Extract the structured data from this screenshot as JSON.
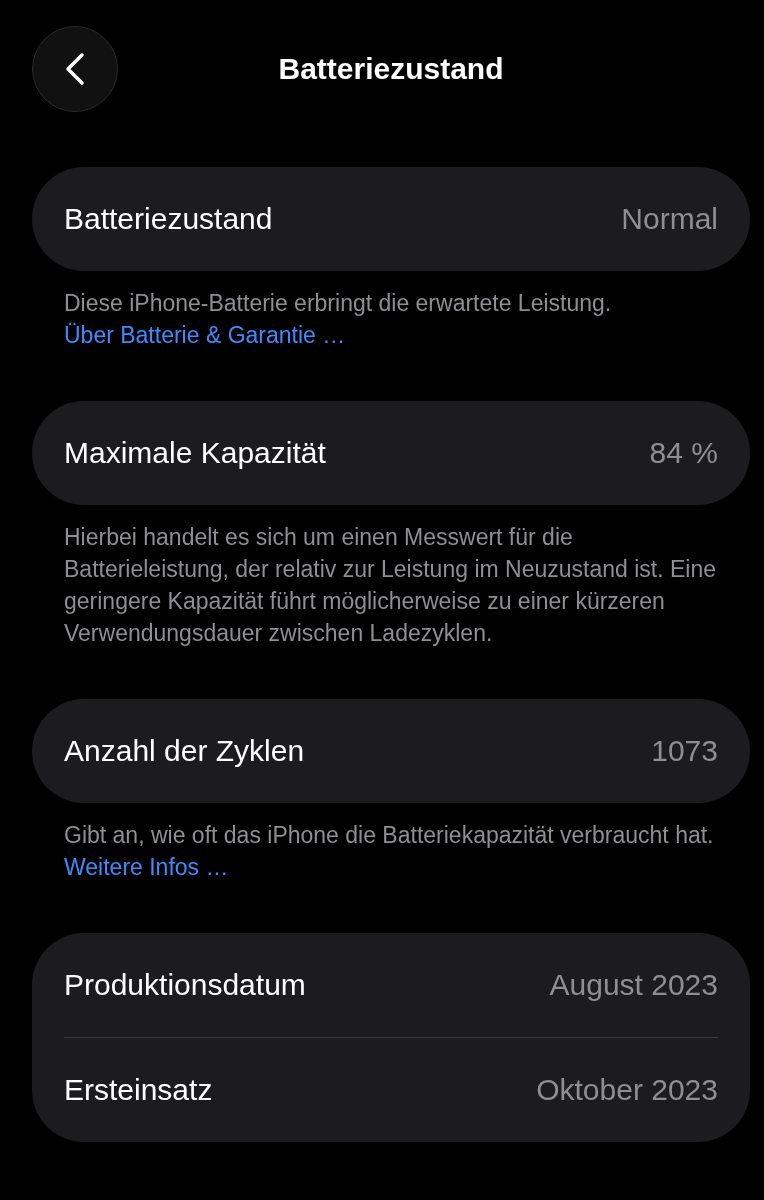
{
  "header": {
    "title": "Batteriezustand"
  },
  "sections": [
    {
      "rows": [
        {
          "label": "Batteriezustand",
          "value": "Normal"
        }
      ],
      "footer": {
        "text": "Diese iPhone-Batterie erbringt die erwartete Leistung.",
        "link": "Über Batterie & Garantie …"
      }
    },
    {
      "rows": [
        {
          "label": "Maximale Kapazität",
          "value": "84 %"
        }
      ],
      "footer": {
        "text": "Hierbei handelt es sich um einen Messwert für die Batterieleistung, der relativ zur Leistung im Neuzustand ist. Eine geringere Kapazität führt möglicherweise zu einer kürzeren Verwendungsdauer zwischen Ladezyklen."
      }
    },
    {
      "rows": [
        {
          "label": "Anzahl der Zyklen",
          "value": "1073"
        }
      ],
      "footer": {
        "text": "Gibt an, wie oft das iPhone die Batteriekapazität verbraucht hat.",
        "link": "Weitere Infos …"
      }
    },
    {
      "rows": [
        {
          "label": "Produktionsdatum",
          "value": "August 2023"
        },
        {
          "label": "Ersteinsatz",
          "value": "Oktober 2023"
        }
      ]
    }
  ]
}
